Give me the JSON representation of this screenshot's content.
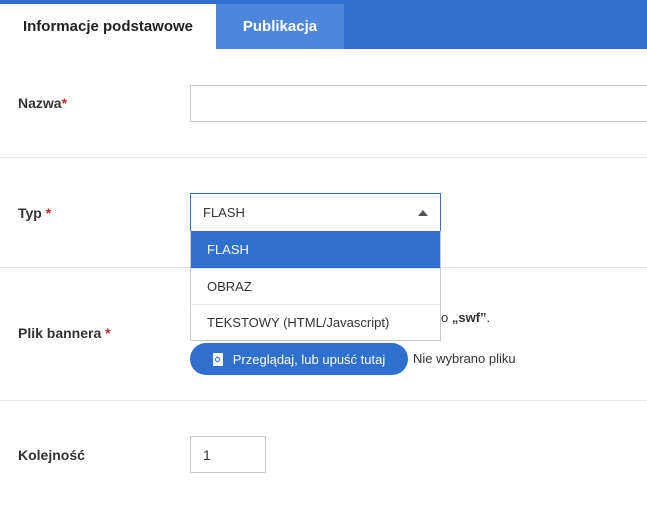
{
  "tabs": [
    {
      "label": "Informacje podstawowe"
    },
    {
      "label": "Publikacja"
    }
  ],
  "form": {
    "name": {
      "label": "Nazwa",
      "required": "*",
      "value": ""
    },
    "type": {
      "label": "Typ",
      "required": "*",
      "selected": "FLASH",
      "options": [
        "FLASH",
        "OBRAZ",
        "TEKSTOWY (HTML/Javascript)"
      ]
    },
    "file": {
      "label": "Plik bannera",
      "required": "*",
      "hint_prefix": "o",
      "hint_ext": "„swf”",
      "hint_suffix": ".",
      "browse_label": "Przeglądaj, lub upuść tutaj",
      "status": "Nie wybrano pliku"
    },
    "order": {
      "label": "Kolejność",
      "value": "1"
    }
  },
  "colors": {
    "accent": "#2f6fcf",
    "tab_inactive": "#4e86dc",
    "required": "#c62828"
  }
}
